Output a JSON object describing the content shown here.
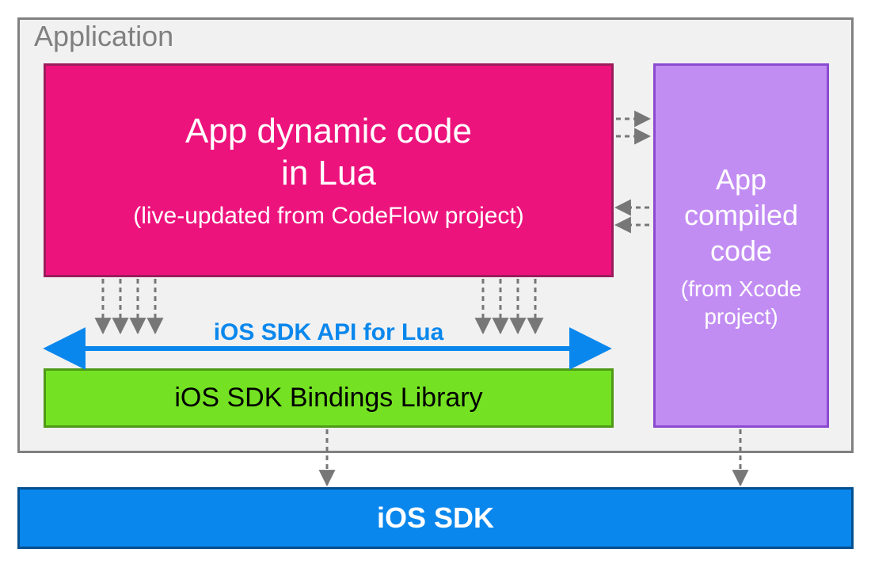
{
  "application": {
    "title": "Application",
    "lua_box": {
      "title_line1": "App dynamic code",
      "title_line2": "in Lua",
      "subtitle": "(live-updated from CodeFlow project)"
    },
    "compiled_box": {
      "title_line1": "App",
      "title_line2": "compiled",
      "title_line3": "code",
      "subtitle_line1": "(from Xcode",
      "subtitle_line2": "project)"
    },
    "api_label": "iOS SDK API for Lua",
    "bindings_label": "iOS SDK Bindings Library"
  },
  "sdk_label": "iOS SDK",
  "colors": {
    "app_bg": "#f1f1f1",
    "app_border": "#808080",
    "lua_bg": "#ed137d",
    "lua_border": "#9b1c5b",
    "compiled_bg": "#c28df3",
    "compiled_border": "#8a4bd0",
    "bindings_bg": "#74e222",
    "bindings_border": "#4f9a17",
    "sdk_bg": "#0a87ed",
    "sdk_border": "#034f8f",
    "api_text": "#0a87ed",
    "arrow_gray": "#777777"
  },
  "chart_data": {
    "type": "diagram",
    "title": "Application architecture with Lua dynamic code and iOS SDK",
    "nodes": [
      {
        "id": "application",
        "label": "Application",
        "contains": [
          "lua",
          "compiled",
          "api",
          "bindings"
        ]
      },
      {
        "id": "lua",
        "label": "App dynamic code in Lua",
        "subtitle": "live-updated from CodeFlow project"
      },
      {
        "id": "compiled",
        "label": "App compiled code",
        "subtitle": "from Xcode project"
      },
      {
        "id": "api",
        "label": "iOS SDK API for Lua"
      },
      {
        "id": "bindings",
        "label": "iOS SDK Bindings Library"
      },
      {
        "id": "ios_sdk",
        "label": "iOS SDK"
      }
    ],
    "edges": [
      {
        "from": "lua",
        "to": "compiled",
        "style": "dashed",
        "direction": "bidirectional",
        "count": 4
      },
      {
        "from": "lua",
        "to": "api",
        "style": "dashed",
        "direction": "down",
        "count": 8
      },
      {
        "from": "api",
        "style": "solid",
        "direction": "bidirectional_horizontal"
      },
      {
        "from": "bindings",
        "to": "ios_sdk",
        "style": "dashed",
        "direction": "down",
        "count": 1
      },
      {
        "from": "compiled",
        "to": "ios_sdk",
        "style": "dashed",
        "direction": "down",
        "count": 1
      }
    ]
  }
}
